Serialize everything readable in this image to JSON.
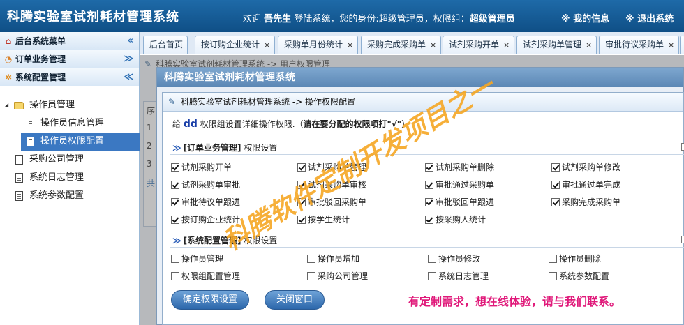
{
  "header": {
    "app_title": "科腾实验室试剂耗材管理系统",
    "welcome_prefix": "欢迎",
    "user_name": "吾先生",
    "welcome_mid": "登陆系统，您的身份:超级管理员，权限组：",
    "role_group": "超级管理员",
    "my_info": "※ 我的信息",
    "logout": "※ 退出系统"
  },
  "sidebar": {
    "sections": [
      {
        "label": "后台系统菜单",
        "chevron": "«"
      },
      {
        "label": "订单业务管理",
        "chevron": "≫"
      },
      {
        "label": "系统配置管理",
        "chevron": "≪"
      }
    ],
    "tree": {
      "folder": "操作员管理",
      "children": [
        "操作员信息管理",
        "操作员权限配置"
      ],
      "items": [
        "采购公司管理",
        "系统日志管理",
        "系统参数配置"
      ]
    }
  },
  "tabs": [
    {
      "label": "后台首页",
      "closable": false
    },
    {
      "label": "按订购企业统计",
      "closable": true
    },
    {
      "label": "采购单月份统计",
      "closable": true
    },
    {
      "label": "采购完成采购单",
      "closable": true
    },
    {
      "label": "试剂采购开单",
      "closable": true
    },
    {
      "label": "试剂采购单管理",
      "closable": true
    },
    {
      "label": "审批待议采购单",
      "closable": true
    }
  ],
  "background": {
    "breadcrumb": "科腾实验室试剂耗材管理系统 -> 用户权限管理",
    "col_header": "序",
    "rows": [
      "1",
      "2",
      "3"
    ],
    "footer": "共"
  },
  "outer_dialog": {
    "title": "科腾实验室试剂耗材管理系统"
  },
  "dialog": {
    "breadcrumb": "科腾实验室试剂耗材管理系统 -> 操作权限配置",
    "intro_prefix": "给",
    "group_name": "dd",
    "intro_mid": "权限组设置详细操作权限.（",
    "intro_hint": "请在要分配的权限项打\"√\"",
    "intro_suffix": "）",
    "section1": {
      "arrows": "≫",
      "name": "[订单业务管理]",
      "suffix": "权限设置",
      "items": [
        {
          "label": "试剂采购开单",
          "checked": true
        },
        {
          "label": "试剂采购单管理",
          "checked": true
        },
        {
          "label": "试剂采购单删除",
          "checked": true
        },
        {
          "label": "试剂采购单修改",
          "checked": true
        },
        {
          "label": "试剂采购单审批",
          "checked": true
        },
        {
          "label": "试剂采购单审核",
          "checked": true
        },
        {
          "label": "审批通过采购单",
          "checked": true
        },
        {
          "label": "审批通过单完成",
          "checked": true
        },
        {
          "label": "审批待议单跟进",
          "checked": true
        },
        {
          "label": "审批驳回采购单",
          "checked": true
        },
        {
          "label": "审批驳回单跟进",
          "checked": true
        },
        {
          "label": "采购完成采购单",
          "checked": true
        },
        {
          "label": "按订购企业统计",
          "checked": true
        },
        {
          "label": "按学生统计",
          "checked": true
        },
        {
          "label": "按采购人统计",
          "checked": true
        }
      ]
    },
    "section2": {
      "arrows": "≫",
      "name": "[系统配置管理]",
      "suffix": "权限设置",
      "items": [
        {
          "label": "操作员管理",
          "checked": false
        },
        {
          "label": "操作员增加",
          "checked": false
        },
        {
          "label": "操作员修改",
          "checked": false
        },
        {
          "label": "操作员删除",
          "checked": false
        },
        {
          "label": "权限组配置管理",
          "checked": false
        },
        {
          "label": "采购公司管理",
          "checked": false
        },
        {
          "label": "系统日志管理",
          "checked": false
        },
        {
          "label": "系统参数配置",
          "checked": false
        }
      ]
    },
    "confirm_button": "确定权限设置",
    "close_button": "关闭窗口",
    "promo": "有定制需求，想在线体验，请与我们联系。"
  },
  "watermark": {
    "text": "科腾软件定制开发项目之一",
    "color": "#f5a623"
  }
}
